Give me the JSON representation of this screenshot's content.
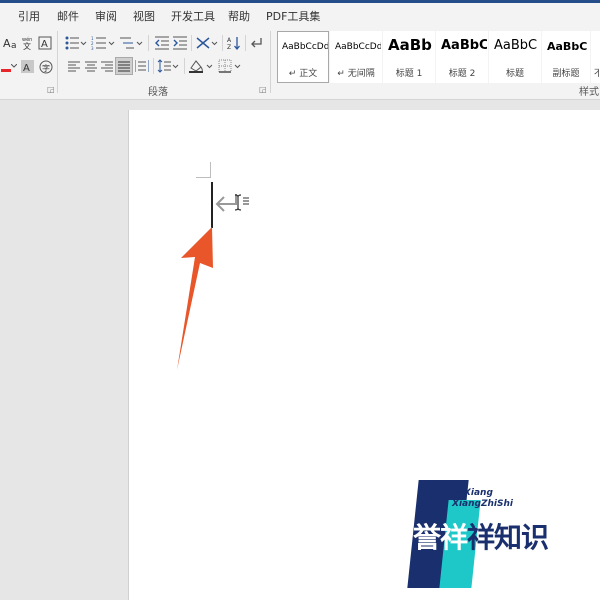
{
  "tabs": [
    "引用",
    "邮件",
    "审阅",
    "视图",
    "开发工具",
    "帮助",
    "PDF工具集"
  ],
  "ribbon": {
    "paragraph_group_label": "段落",
    "styles_group_label": "样式",
    "font_format_letter": "A",
    "styles": [
      {
        "sample": "AaBbCcDd",
        "name": "↵ 正文",
        "selected": true
      },
      {
        "sample": "AaBbCcDd",
        "name": "↵ 无间隔",
        "selected": false
      },
      {
        "sample": "AaBb",
        "name": "标题 1",
        "selected": false
      },
      {
        "sample": "AaBbC",
        "name": "标题 2",
        "selected": false
      },
      {
        "sample": "AaBbC",
        "name": "标题",
        "selected": false
      },
      {
        "sample": "AaBbC",
        "name": "副标题",
        "selected": false
      },
      {
        "sample": "",
        "name": "不",
        "selected": false
      }
    ]
  },
  "watermark": {
    "line1": "YuXiang",
    "line2": "XiangZhiShi",
    "brand_part1": "誉祥",
    "brand_part2": "祥知识"
  },
  "colors": {
    "accent": "#2b579a",
    "arrow": "#e8562a",
    "watermark_dark": "#1a2f6d",
    "watermark_cyan": "#1ec8c8"
  }
}
